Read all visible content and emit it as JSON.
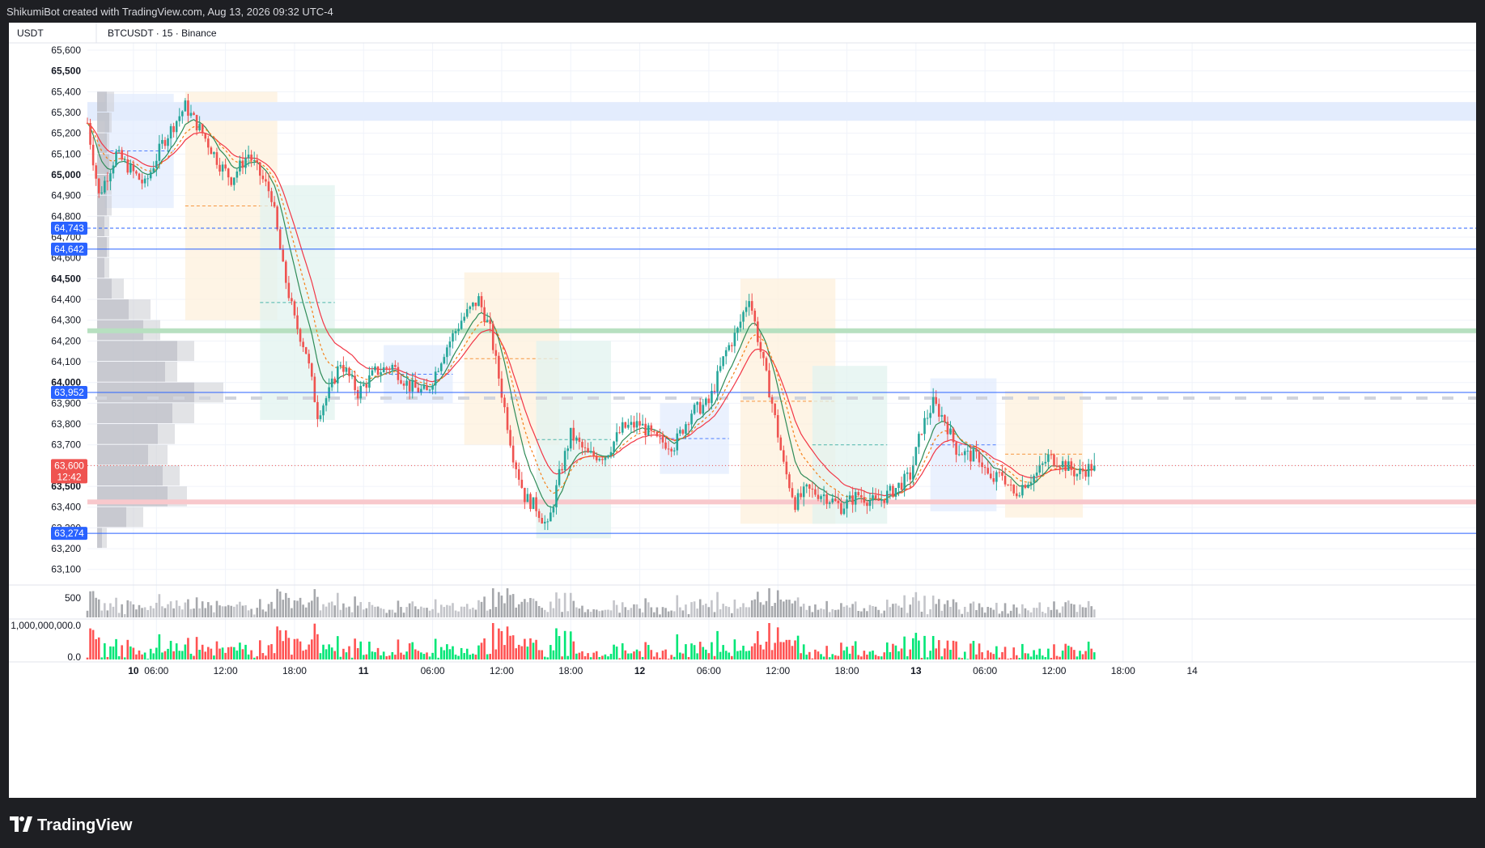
{
  "header": {
    "credit": "ShikumiBot created with TradingView.com, Aug 13, 2026 09:32 UTC-4"
  },
  "toolbar": {
    "currency": "USDT",
    "symbol": "BTCUSDT · 15 · Binance"
  },
  "branding": {
    "logo_text": "TradingView"
  },
  "colors": {
    "up": "#26a69a",
    "down": "#ef5350",
    "up_bright": "#00e676",
    "down_bright": "#ff5252",
    "ma_red": "#f23645",
    "ma_green": "#2e8b57",
    "ma_orange": "#f57f17",
    "level_blue": "#2962ff",
    "zone_blue": "#e3ecfd",
    "zone_orange": "#fdf0dc",
    "zone_teal": "#e2f3ef",
    "green_band": "#b7e0c0",
    "red_band": "#f8c8cc"
  },
  "chart_data": {
    "type": "candlestick",
    "symbol": "BTCUSDT",
    "interval": "15",
    "exchange": "Binance",
    "ylim": [
      63025,
      65635
    ],
    "y_ticks": [
      "63,100",
      "63,200",
      "63,300",
      "63,400",
      "63,500",
      "63,600",
      "63,700",
      "63,800",
      "63,900",
      "64,000",
      "64,100",
      "64,200",
      "64,300",
      "64,400",
      "64,500",
      "64,600",
      "64,700",
      "64,800",
      "64,900",
      "65,000",
      "65,100",
      "65,200",
      "65,300",
      "65,400",
      "65,500",
      "65,600"
    ],
    "bold_ticks": [
      "63,500",
      "64,000",
      "64,500",
      "65,000",
      "65,500"
    ],
    "x_ticks": [
      {
        "t": 16,
        "label": "10",
        "bold": true
      },
      {
        "t": 24,
        "label": "06:00"
      },
      {
        "t": 48,
        "label": "12:00"
      },
      {
        "t": 72,
        "label": "18:00"
      },
      {
        "t": 96,
        "label": "11",
        "bold": true
      },
      {
        "t": 120,
        "label": "06:00"
      },
      {
        "t": 144,
        "label": "12:00"
      },
      {
        "t": 168,
        "label": "18:00"
      },
      {
        "t": 192,
        "label": "12",
        "bold": true
      },
      {
        "t": 216,
        "label": "06:00"
      },
      {
        "t": 240,
        "label": "12:00"
      },
      {
        "t": 264,
        "label": "18:00"
      },
      {
        "t": 288,
        "label": "13",
        "bold": true
      },
      {
        "t": 312,
        "label": "06:00"
      },
      {
        "t": 336,
        "label": "12:00"
      },
      {
        "t": 360,
        "label": "18:00"
      },
      {
        "t": 384,
        "label": "14"
      }
    ],
    "last_bar_t": 350,
    "price_path": [
      [
        0,
        65250
      ],
      [
        4,
        64900
      ],
      [
        10,
        65100
      ],
      [
        20,
        64950
      ],
      [
        26,
        65150
      ],
      [
        34,
        65330
      ],
      [
        40,
        65200
      ],
      [
        46,
        65050
      ],
      [
        50,
        64980
      ],
      [
        56,
        65100
      ],
      [
        60,
        65000
      ],
      [
        64,
        64900
      ],
      [
        68,
        64550
      ],
      [
        72,
        64300
      ],
      [
        76,
        64150
      ],
      [
        80,
        63850
      ],
      [
        84,
        63950
      ],
      [
        88,
        64100
      ],
      [
        94,
        63950
      ],
      [
        100,
        64050
      ],
      [
        106,
        64080
      ],
      [
        112,
        63980
      ],
      [
        118,
        63950
      ],
      [
        124,
        64150
      ],
      [
        130,
        64300
      ],
      [
        136,
        64400
      ],
      [
        140,
        64250
      ],
      [
        144,
        63950
      ],
      [
        148,
        63650
      ],
      [
        152,
        63450
      ],
      [
        156,
        63400
      ],
      [
        160,
        63300
      ],
      [
        164,
        63550
      ],
      [
        168,
        63750
      ],
      [
        174,
        63650
      ],
      [
        180,
        63650
      ],
      [
        186,
        63780
      ],
      [
        192,
        63800
      ],
      [
        198,
        63720
      ],
      [
        204,
        63700
      ],
      [
        210,
        63860
      ],
      [
        216,
        63900
      ],
      [
        222,
        64150
      ],
      [
        226,
        64250
      ],
      [
        230,
        64420
      ],
      [
        234,
        64150
      ],
      [
        238,
        63900
      ],
      [
        242,
        63600
      ],
      [
        246,
        63420
      ],
      [
        250,
        63480
      ],
      [
        256,
        63460
      ],
      [
        262,
        63400
      ],
      [
        268,
        63460
      ],
      [
        274,
        63420
      ],
      [
        280,
        63480
      ],
      [
        286,
        63550
      ],
      [
        290,
        63780
      ],
      [
        294,
        63900
      ],
      [
        298,
        63820
      ],
      [
        302,
        63680
      ],
      [
        306,
        63650
      ],
      [
        310,
        63640
      ],
      [
        314,
        63520
      ],
      [
        318,
        63560
      ],
      [
        322,
        63460
      ],
      [
        326,
        63520
      ],
      [
        330,
        63560
      ],
      [
        334,
        63640
      ],
      [
        338,
        63620
      ],
      [
        344,
        63560
      ],
      [
        350,
        63600
      ]
    ],
    "ohlc_last": {
      "close": 63600
    },
    "current_price": {
      "label": "63,600",
      "countdown": "12:42",
      "value": 63600
    },
    "price_levels": [
      {
        "label": "64,743",
        "value": 64743,
        "style": "dashed"
      },
      {
        "label": "64,642",
        "value": 64642,
        "style": "solid"
      },
      {
        "label": "63,952",
        "value": 63952,
        "style": "solid"
      },
      {
        "label": "63,274",
        "value": 63274,
        "style": "solid"
      }
    ],
    "bands": [
      {
        "value": 64249,
        "color": "green"
      },
      {
        "value": 63425,
        "color": "red"
      }
    ],
    "volume_panel": {
      "y_label": "500",
      "ymax": 700
    },
    "delta_panel": {
      "y_label_top": "1,000,000,000.0",
      "y_label_bottom": "0.0"
    },
    "zones": [
      {
        "t0": 6,
        "t1": 30,
        "top": 65390,
        "bottom": 64840,
        "color": "blue"
      },
      {
        "t0": 34,
        "t1": 66,
        "top": 65400,
        "bottom": 64300,
        "color": "orange"
      },
      {
        "t0": 60,
        "t1": 86,
        "top": 64950,
        "bottom": 63820,
        "color": "teal"
      },
      {
        "t0": 103,
        "t1": 127,
        "top": 64180,
        "bottom": 63900,
        "color": "blue"
      },
      {
        "t0": 131,
        "t1": 164,
        "top": 64530,
        "bottom": 63700,
        "color": "orange"
      },
      {
        "t0": 156,
        "t1": 182,
        "top": 64200,
        "bottom": 63250,
        "color": "teal"
      },
      {
        "t0": 199,
        "t1": 223,
        "top": 63900,
        "bottom": 63560,
        "color": "blue"
      },
      {
        "t0": 227,
        "t1": 260,
        "top": 64500,
        "bottom": 63320,
        "color": "orange"
      },
      {
        "t0": 252,
        "t1": 278,
        "top": 64080,
        "bottom": 63320,
        "color": "teal"
      },
      {
        "t0": 293,
        "t1": 316,
        "top": 64020,
        "bottom": 63380,
        "color": "blue"
      },
      {
        "t0": 319,
        "t1": 346,
        "top": 63960,
        "bottom": 63350,
        "color": "orange"
      }
    ],
    "volume_profile_rows": [
      {
        "price": 65350,
        "a": 0.07,
        "b": 0.04
      },
      {
        "price": 65250,
        "a": 0.06,
        "b": 0.05
      },
      {
        "price": 65150,
        "a": 0.05,
        "b": 0.04
      },
      {
        "price": 65050,
        "a": 0.07,
        "b": 0.05
      },
      {
        "price": 64950,
        "a": 0.06,
        "b": 0.04
      },
      {
        "price": 64850,
        "a": 0.06,
        "b": 0.04
      },
      {
        "price": 64750,
        "a": 0.05,
        "b": 0.03
      },
      {
        "price": 64650,
        "a": 0.05,
        "b": 0.04
      },
      {
        "price": 64550,
        "a": 0.05,
        "b": 0.03
      },
      {
        "price": 64450,
        "a": 0.11,
        "b": 0.06
      },
      {
        "price": 64350,
        "a": 0.22,
        "b": 0.13
      },
      {
        "price": 64250,
        "a": 0.26,
        "b": 0.19
      },
      {
        "price": 64150,
        "a": 0.4,
        "b": 0.33
      },
      {
        "price": 64050,
        "a": 0.33,
        "b": 0.28
      },
      {
        "price": 63950,
        "a": 0.52,
        "b": 0.4
      },
      {
        "price": 63850,
        "a": 0.4,
        "b": 0.31
      },
      {
        "price": 63750,
        "a": 0.32,
        "b": 0.25
      },
      {
        "price": 63650,
        "a": 0.29,
        "b": 0.21
      },
      {
        "price": 63550,
        "a": 0.34,
        "b": 0.27
      },
      {
        "price": 63450,
        "a": 0.37,
        "b": 0.29
      },
      {
        "price": 63350,
        "a": 0.19,
        "b": 0.12
      },
      {
        "price": 63250,
        "a": 0.04,
        "b": 0.02
      }
    ]
  }
}
